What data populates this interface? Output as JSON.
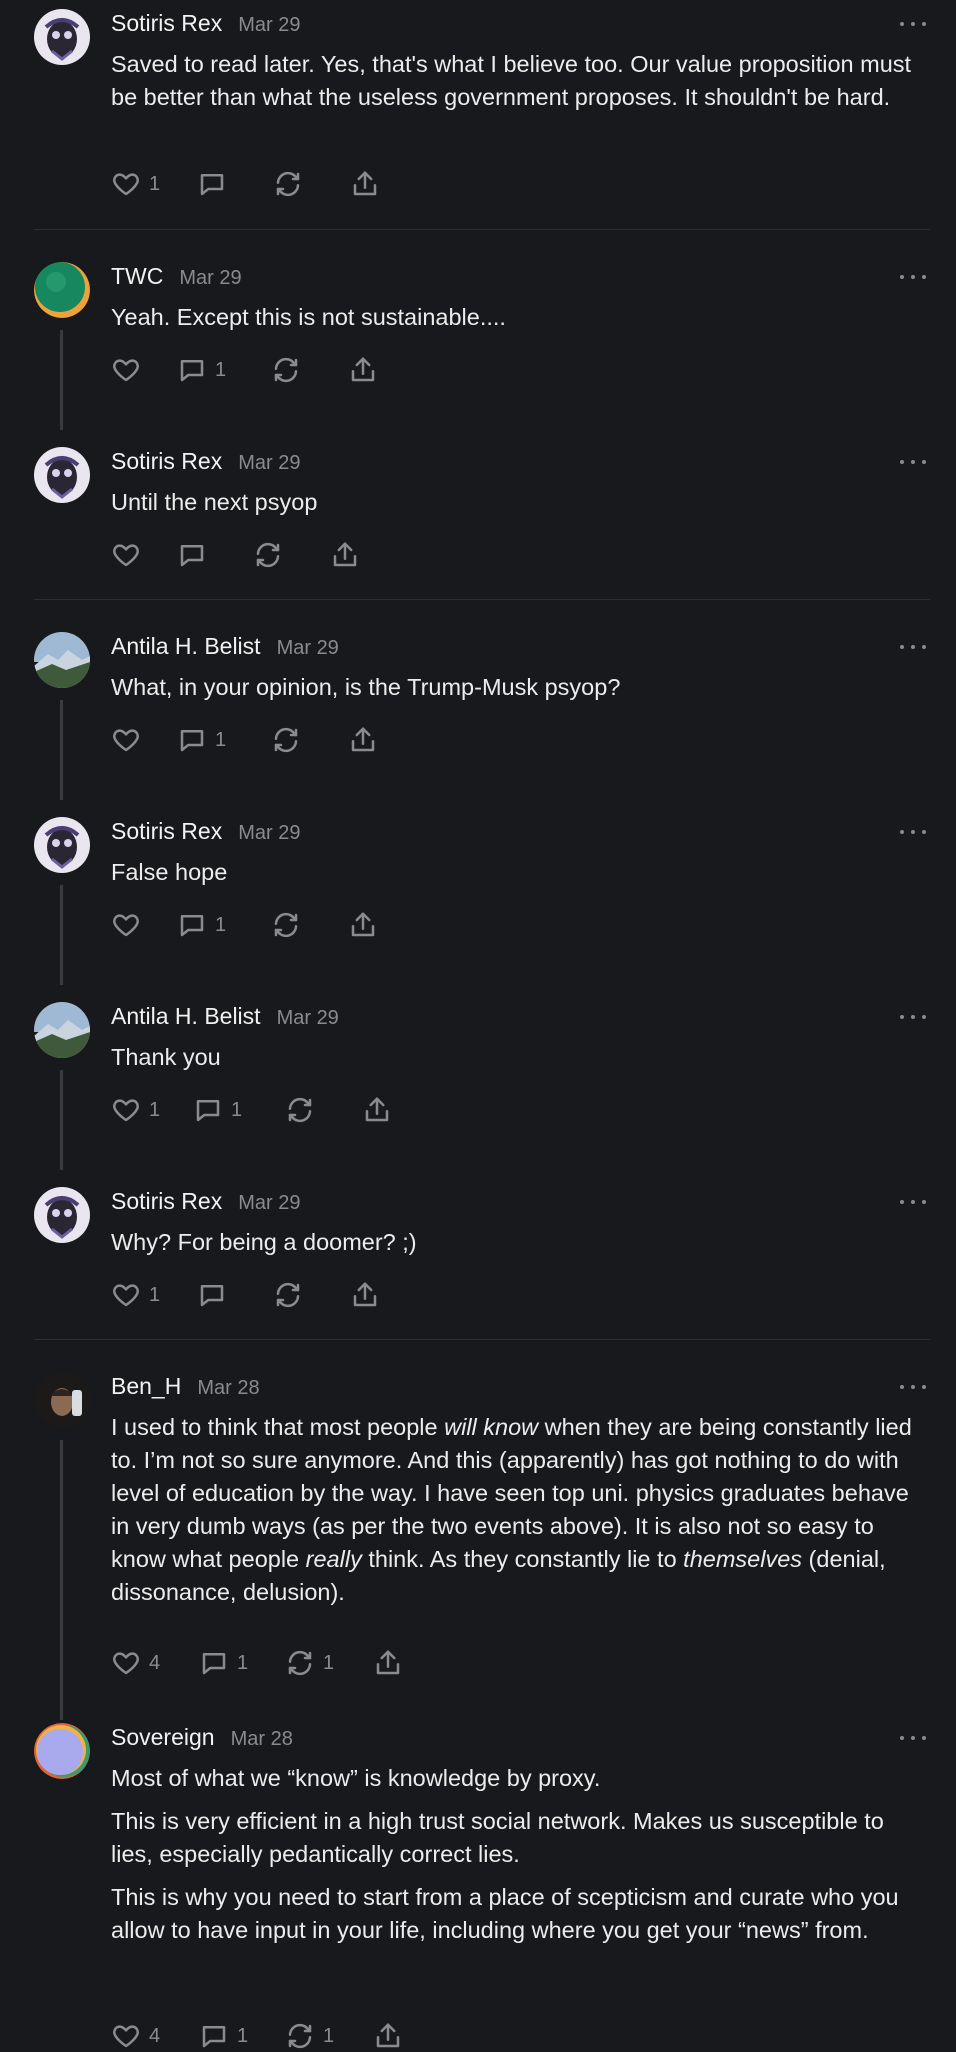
{
  "comments": [
    {
      "author": "Sotiris Rex",
      "date": "Mar 29",
      "paragraphs": [
        "Saved to read later. Yes, that's what I believe too. Our value proposition must be better than what the useless government proposes. It shouldn't be hard."
      ],
      "likes": "1",
      "replies": "",
      "restacks": ""
    },
    {
      "author": "TWC",
      "date": "Mar 29",
      "paragraphs": [
        "Yeah. Except this is not sustainable...."
      ],
      "likes": "",
      "replies": "1",
      "restacks": ""
    },
    {
      "author": "Sotiris Rex",
      "date": "Mar 29",
      "paragraphs": [
        "Until the next psyop"
      ],
      "likes": "",
      "replies": "",
      "restacks": ""
    },
    {
      "author": "Antila H. Belist",
      "date": "Mar 29",
      "paragraphs": [
        "What, in your opinion, is the Trump-Musk psyop?"
      ],
      "likes": "",
      "replies": "1",
      "restacks": ""
    },
    {
      "author": "Sotiris Rex",
      "date": "Mar 29",
      "paragraphs": [
        "False hope"
      ],
      "likes": "",
      "replies": "1",
      "restacks": ""
    },
    {
      "author": "Antila H. Belist",
      "date": "Mar 29",
      "paragraphs": [
        "Thank you"
      ],
      "likes": "1",
      "replies": "1",
      "restacks": ""
    },
    {
      "author": "Sotiris Rex",
      "date": "Mar 29",
      "paragraphs": [
        "Why? For being a doomer? ;)"
      ],
      "likes": "1",
      "replies": "",
      "restacks": ""
    },
    {
      "author": "Ben_H",
      "date": "Mar 28",
      "rich": {
        "p1": "I used to think that most people ",
        "em1": "will know",
        "p2": " when they are being constantly lied to. I’m not so sure anymore. And this (apparently) has got nothing to do with level of education by the way. I have seen top uni. physics graduates behave in very dumb ways (as per the two events above). It is also not so easy to know what people ",
        "em2": "really",
        "p3": " think. As they constantly lie to ",
        "em3": "themselves",
        "p4": " (denial, dissonance, delusion)."
      },
      "likes": "4",
      "replies": "1",
      "restacks": "1"
    },
    {
      "author": "Sovereign",
      "date": "Mar 28",
      "paragraphs": [
        "Most of what we “know” is knowledge by proxy.",
        "This is very efficient in a high trust social network. Makes us susceptible to lies, especially pedantically correct lies.",
        "This is why you need to start from a place of scepticism and curate who you allow to have input in your life, including where you get your “news” from."
      ],
      "likes": "4",
      "replies": "1",
      "restacks": "1"
    }
  ],
  "icons": {
    "like": "heart-icon",
    "reply": "speech-bubble-icon",
    "restack": "restack-arrows-icon",
    "share": "share-upload-icon",
    "more": "ellipsis-icon"
  },
  "colors": {
    "background": "#18191c",
    "text": "#ececec",
    "muted": "#8a8b8f",
    "thread_line": "#3a3b3f"
  }
}
